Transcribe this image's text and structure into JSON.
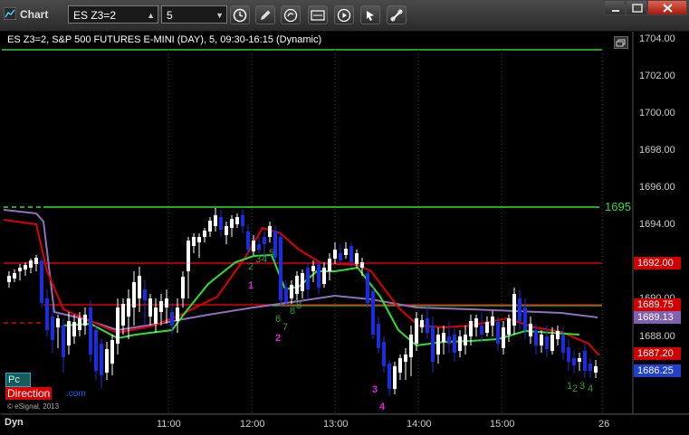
{
  "window": {
    "title": "Chart"
  },
  "toolbar": {
    "symbol": "ES Z3=2",
    "interval": "5",
    "buttons": [
      "clock-icon",
      "pencil-icon",
      "refresh-icon",
      "study-icon",
      "play-icon",
      "link-icon"
    ]
  },
  "chart": {
    "title": "ES Z3=2, S&P 500 FUTURES E-MINI (DAY), 5, 09:30-16:15 (Dynamic)",
    "price_labels": [
      "1704.00",
      "1702.00",
      "1700.00",
      "1698.00",
      "1696.00",
      "1694.00",
      "1688.00"
    ],
    "overlapped_label": "1690.00",
    "badges": [
      {
        "text": "1692.00",
        "bg": "#d40000",
        "fg": "#ffffff"
      },
      {
        "text": "1689.75",
        "bg": "#d40000",
        "fg": "#ffffff"
      },
      {
        "text": "1689.13",
        "bg": "#8060b0",
        "fg": "#ffffff"
      },
      {
        "text": "1687.20",
        "bg": "#d40000",
        "fg": "#ffffff"
      },
      {
        "text": "1686.25",
        "bg": "#2040d0",
        "fg": "#ffffff"
      }
    ],
    "time_labels": [
      "11:00",
      "12:00",
      "13:00",
      "14:00",
      "15:00",
      "26"
    ],
    "level_label": "1695",
    "counts": {
      "c1": "1",
      "c2": "2",
      "c3": "3",
      "c4": "4",
      "g1": "2",
      "g2": "3",
      "g3": "4",
      "g4": "5",
      "g5": "6",
      "g6": "7",
      "g7": "8",
      "g8": "8",
      "e1": "1",
      "e2": "2",
      "e3": "3",
      "e4": "4"
    },
    "logo": {
      "pc": "Pc",
      "direction": "Direction",
      "suffix": ".com"
    },
    "copyright": "© eSignal, 2013",
    "footer_label": "Dyn"
  },
  "colors": {
    "bull_candle": "#ffffff",
    "bear_candle": "#1a2ee0",
    "red_line": "#e00000",
    "green_line": "#30e030",
    "purple_line": "#9070c0",
    "grid": "#2a5a2a"
  }
}
